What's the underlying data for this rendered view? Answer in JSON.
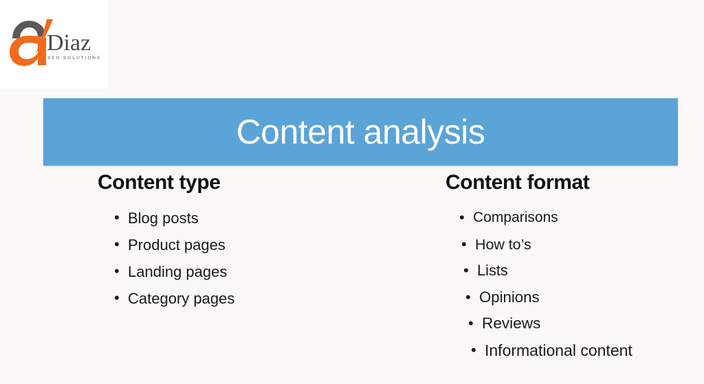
{
  "logo": {
    "mark_icon": "stylized-letter-a-logo",
    "name": "Diaz",
    "tagline": "SEO SOLUTIONS",
    "orange": "#F26A1B",
    "grey": "#5A5A5A",
    "word_color": "#4C4C4C"
  },
  "banner": {
    "title": "Content analysis",
    "background": "#5BA4D7",
    "text_color": "#FFFFFF"
  },
  "columns": [
    {
      "heading": "Content type",
      "items": [
        "Blog posts",
        "Product pages",
        "Landing pages",
        "Category pages"
      ]
    },
    {
      "heading": "Content format",
      "items": [
        "Comparisons",
        "How to’s",
        "Lists",
        "Opinions",
        "Reviews",
        "Informational content"
      ]
    }
  ],
  "bullet_glyph": "•",
  "page_background": "#FAF9F8"
}
